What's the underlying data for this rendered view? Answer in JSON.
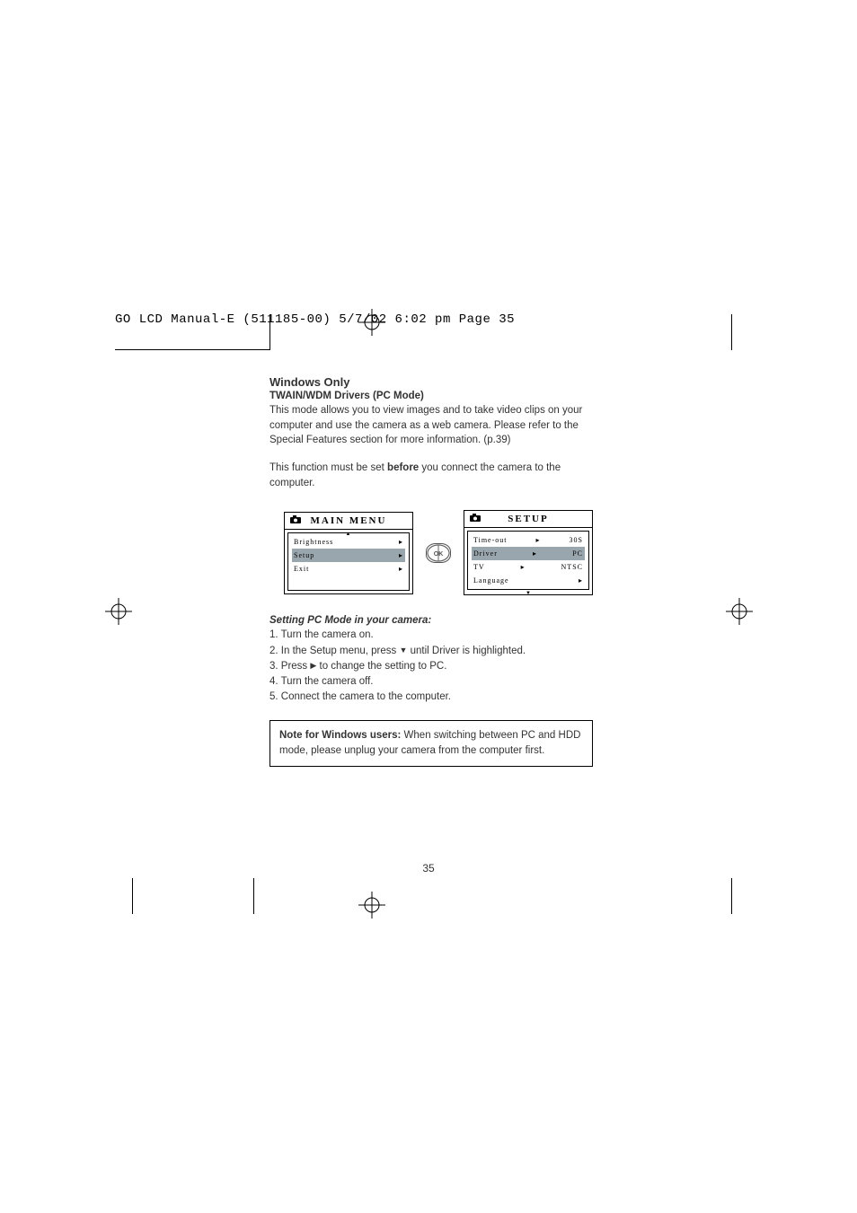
{
  "header": "GO LCD Manual-E (511185-00)   5/7/02  6:02 pm  Page 35",
  "section": {
    "title1": "Windows Only",
    "title2": "TWAIN/WDM Drivers (PC Mode)",
    "para1": "This mode allows you to view images and to take video clips on your computer and use the camera as a web camera.  Please refer to the Special Features section for more information. (p.39)",
    "para2a": "This function must be set ",
    "para2_bold": "before",
    "para2b": " you connect the camera to the computer."
  },
  "menus": {
    "main": {
      "title": "MAIN MENU",
      "items": [
        {
          "label": "Brightness",
          "hl": false
        },
        {
          "label": "Setup",
          "hl": true
        },
        {
          "label": "Exit",
          "hl": false
        }
      ]
    },
    "ok_label": "OK",
    "setup": {
      "title": "SETUP",
      "rows": [
        {
          "k": "Time-out",
          "v": "30S",
          "hl": false
        },
        {
          "k": "Driver",
          "v": "PC",
          "hl": true
        },
        {
          "k": "TV",
          "v": "NTSC",
          "hl": false
        },
        {
          "k": "Language",
          "v": "",
          "hl": false
        }
      ]
    }
  },
  "setting": {
    "heading": "Setting PC Mode in your camera:",
    "step1": "1. Turn the camera on.",
    "step2a": "2. In the Setup menu, press  ",
    "step2b": " until Driver is highlighted.",
    "step3a": "3. Press ",
    "step3b": " to change the setting to PC.",
    "step4": "4. Turn the camera off.",
    "step5": "5. Connect the camera to the computer."
  },
  "note": {
    "bold": "Note for Windows users:",
    "text": "  When switching between PC and HDD mode, please unplug your camera from the computer first."
  },
  "page_number": "35"
}
